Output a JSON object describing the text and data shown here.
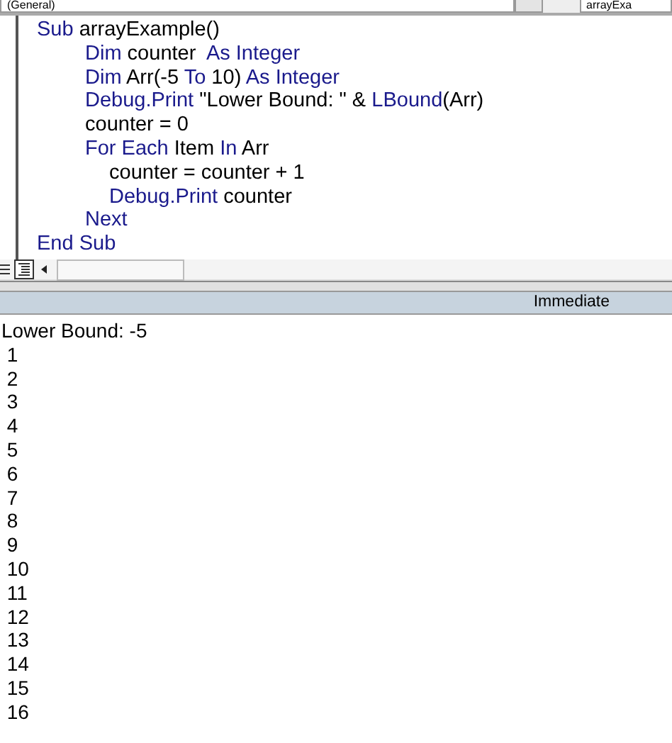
{
  "toolbar": {
    "object_dropdown": "(General)",
    "procedure_dropdown": "arrayExa"
  },
  "code_lines": [
    {
      "tokens": [
        {
          "text": "Sub",
          "kind": "keyword"
        },
        {
          "text": " arrayExample()",
          "kind": "plain"
        }
      ],
      "children": [
        {
          "tokens": [
            {
              "text": "Dim",
              "kind": "keyword"
            },
            {
              "text": " counter  ",
              "kind": "plain"
            },
            {
              "text": "As Integer",
              "kind": "keyword"
            }
          ]
        },
        {
          "tokens": [
            {
              "text": "Dim",
              "kind": "keyword"
            },
            {
              "text": " Arr(-5 ",
              "kind": "plain"
            },
            {
              "text": "To",
              "kind": "keyword"
            },
            {
              "text": " 10) ",
              "kind": "plain"
            },
            {
              "text": "As Integer",
              "kind": "keyword"
            }
          ]
        },
        {
          "tokens": [
            {
              "text": "Debug.Print",
              "kind": "keyword"
            },
            {
              "text": " \"Lower Bound: \" & ",
              "kind": "plain"
            },
            {
              "text": "LBound",
              "kind": "keyword"
            },
            {
              "text": "(Arr)",
              "kind": "plain"
            }
          ]
        },
        {
          "tokens": [
            {
              "text": "counter = 0",
              "kind": "plain"
            }
          ]
        },
        {
          "tokens": [
            {
              "text": "For Each",
              "kind": "keyword"
            },
            {
              "text": " Item ",
              "kind": "plain"
            },
            {
              "text": "In",
              "kind": "keyword"
            },
            {
              "text": " Arr",
              "kind": "plain"
            }
          ],
          "children": [
            {
              "tokens": [
                {
                  "text": "counter = counter + 1",
                  "kind": "plain"
                }
              ]
            },
            {
              "tokens": [
                {
                  "text": "Debug.Print",
                  "kind": "keyword"
                },
                {
                  "text": " counter",
                  "kind": "plain"
                }
              ]
            }
          ]
        },
        {
          "tokens": [
            {
              "text": "Next",
              "kind": "keyword"
            }
          ]
        }
      ]
    },
    {
      "tokens": [
        {
          "text": "End Sub",
          "kind": "keyword"
        }
      ]
    }
  ],
  "immediate": {
    "title": "Immediate",
    "output": [
      "Lower Bound: -5",
      " 1",
      " 2",
      " 3",
      " 4",
      " 5",
      " 6",
      " 7",
      " 8",
      " 9",
      " 10",
      " 11",
      " 12",
      " 13",
      " 14",
      " 15",
      " 16"
    ]
  }
}
